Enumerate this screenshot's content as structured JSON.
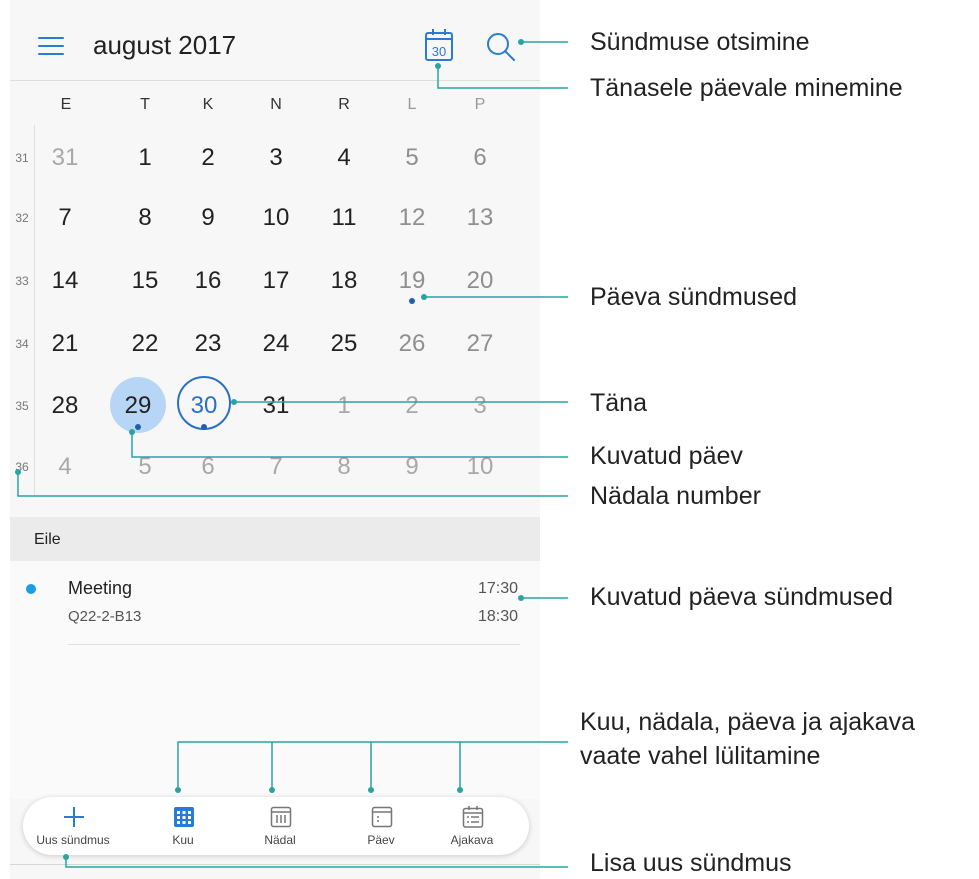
{
  "header": {
    "month_title": "august 2017",
    "today_icon_day": "30"
  },
  "weekdays": [
    "E",
    "T",
    "K",
    "N",
    "R",
    "L",
    "P"
  ],
  "weeks": [
    {
      "number": "31",
      "days": [
        "31",
        "1",
        "2",
        "3",
        "4",
        "5",
        "6"
      ]
    },
    {
      "number": "32",
      "days": [
        "7",
        "8",
        "9",
        "10",
        "11",
        "12",
        "13"
      ]
    },
    {
      "number": "33",
      "days": [
        "14",
        "15",
        "16",
        "17",
        "18",
        "19",
        "20"
      ]
    },
    {
      "number": "34",
      "days": [
        "21",
        "22",
        "23",
        "24",
        "25",
        "26",
        "27"
      ]
    },
    {
      "number": "35",
      "days": [
        "28",
        "29",
        "30",
        "31",
        "1",
        "2",
        "3"
      ]
    },
    {
      "number": "36",
      "days": [
        "4",
        "5",
        "6",
        "7",
        "8",
        "9",
        "10"
      ]
    }
  ],
  "events": {
    "section_title": "Eile",
    "items": [
      {
        "title": "Meeting",
        "location": "Q22-2-B13",
        "start": "17:30",
        "end": "18:30",
        "color": "#1b9de5"
      }
    ]
  },
  "bottom_nav": [
    {
      "label": "Uus sündmus",
      "icon": "plus-icon"
    },
    {
      "label": "Kuu",
      "icon": "month-grid-icon"
    },
    {
      "label": "Nädal",
      "icon": "week-view-icon"
    },
    {
      "label": "Päev",
      "icon": "day-view-icon"
    },
    {
      "label": "Ajakava",
      "icon": "agenda-view-icon"
    }
  ],
  "callouts": {
    "search": "Sündmuse otsimine",
    "go_today": "Tänasele päevale minemine",
    "day_events": "Päeva sündmused",
    "today": "Täna",
    "shown_day": "Kuvatud päev",
    "week_number": "Nädala number",
    "shown_day_events": "Kuvatud päeva sündmused",
    "switch_views_line1": "Kuu, nädala, päeva ja ajakava",
    "switch_views_line2": "vaate vahel lülitamine",
    "add_event": "Lisa uus sündmus"
  },
  "colors": {
    "accent": "#2a7bd6",
    "callout_line": "#2aa3a3",
    "selected_day_fill": "#b7d6f5",
    "event_dot": "#1b9de5"
  }
}
